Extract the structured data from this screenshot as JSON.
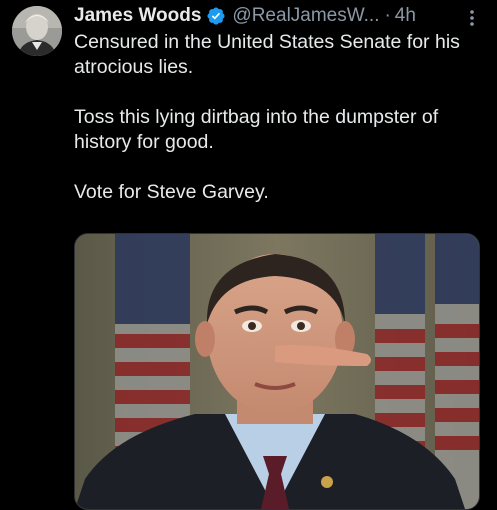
{
  "tweet": {
    "author_name": "James Woods",
    "handle": "@RealJamesW...",
    "separator": "·",
    "time": "4h",
    "more_icon": "more-vertical-icon",
    "verified_icon": "verified-badge-icon",
    "verified_color": "#1d9bf0",
    "paragraphs": [
      "Censured in the United States Senate for his atrocious lies.",
      "Toss this lying dirtbag into the dumpster of history for good.",
      "Vote for Steve Garvey."
    ]
  },
  "colors": {
    "background": "#000000",
    "text": "#e7e9ea",
    "secondary_text": "#8b98a5"
  }
}
